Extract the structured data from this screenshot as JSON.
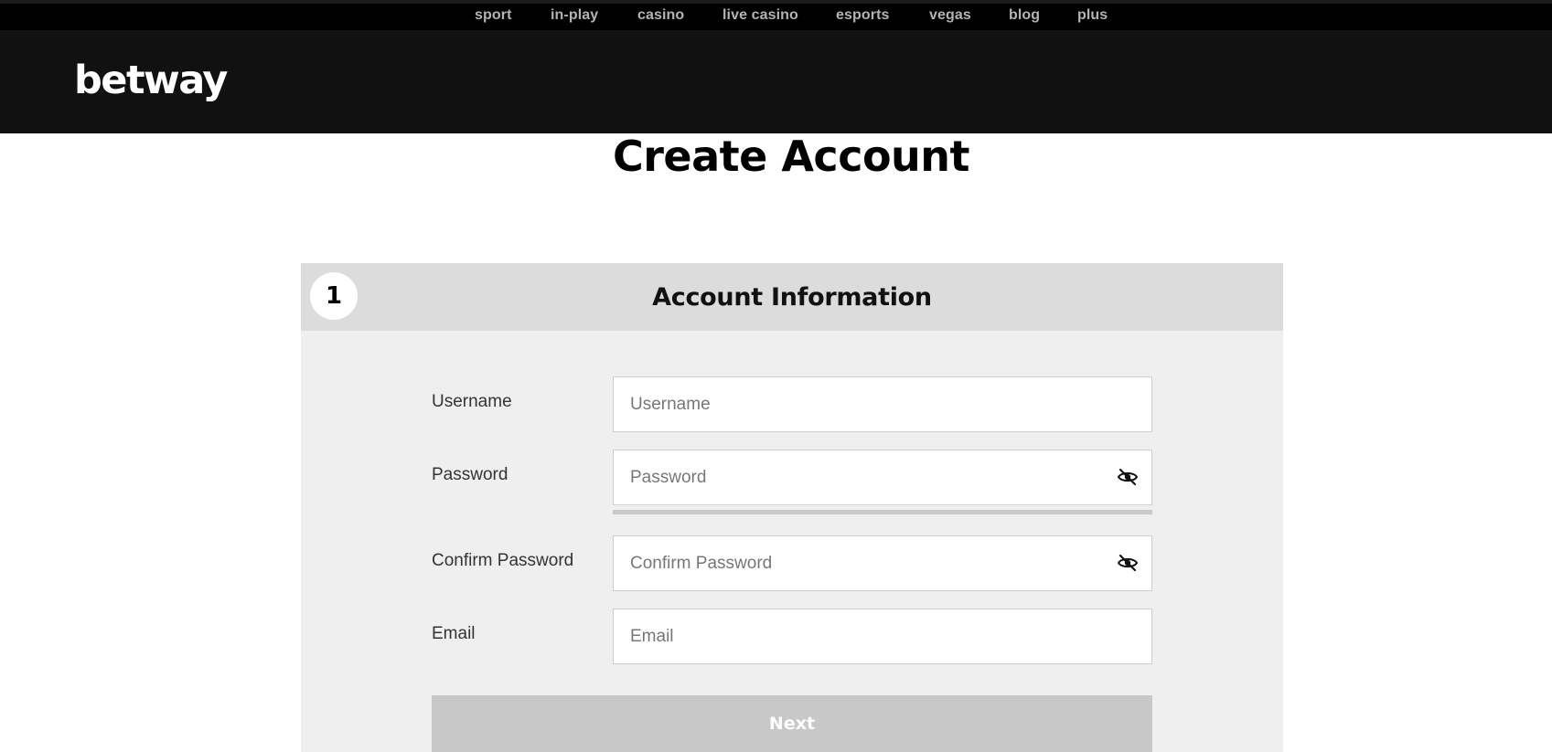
{
  "nav": {
    "items": [
      {
        "label": "sport"
      },
      {
        "label": "in-play"
      },
      {
        "label": "casino"
      },
      {
        "label": "live casino"
      },
      {
        "label": "esports"
      },
      {
        "label": "vegas"
      },
      {
        "label": "blog"
      },
      {
        "label": "plus"
      }
    ]
  },
  "header": {
    "logo_text": "betway"
  },
  "page": {
    "title": "Create Account"
  },
  "step": {
    "number": "1",
    "title": "Account Information"
  },
  "form": {
    "username": {
      "label": "Username",
      "placeholder": "Username",
      "value": ""
    },
    "password": {
      "label": "Password",
      "placeholder": "Password",
      "value": "",
      "icon": "eye-slash-icon"
    },
    "confirm_password": {
      "label": "Confirm Password",
      "placeholder": "Confirm Password",
      "value": "",
      "icon": "eye-slash-icon"
    },
    "email": {
      "label": "Email",
      "placeholder": "Email",
      "value": ""
    },
    "next_label": "Next"
  },
  "colors": {
    "nav_bg": "#000000",
    "header_bg": "#111111",
    "panel_bg": "#efefef",
    "panel_header_bg": "#dcdcdc",
    "button_disabled": "#c8c8c8"
  }
}
